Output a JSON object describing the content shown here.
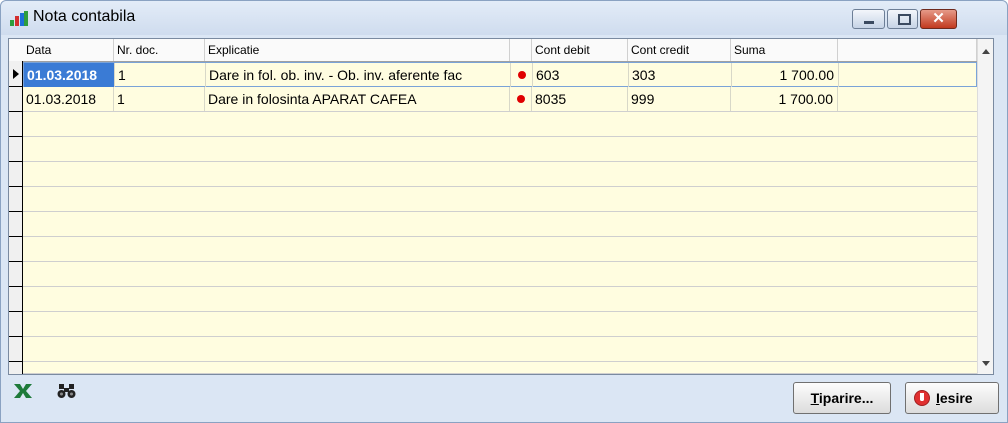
{
  "window": {
    "title": "Nota contabila"
  },
  "table": {
    "columns": [
      {
        "label": "Data"
      },
      {
        "label": "Nr. doc."
      },
      {
        "label": "Explicatie"
      },
      {
        "label": ""
      },
      {
        "label": "Cont debit"
      },
      {
        "label": "Cont credit"
      },
      {
        "label": "Suma"
      },
      {
        "label": ""
      }
    ],
    "rows": [
      {
        "data": "01.03.2018",
        "nr_doc": "1",
        "explicatie": "Dare in fol. ob. inv. - Ob. inv. aferente fac",
        "cont_debit": "603",
        "cont_credit": "303",
        "suma": "1 700.00",
        "selected": true
      },
      {
        "data": "01.03.2018",
        "nr_doc": "1",
        "explicatie": "Dare in folosinta APARAT CAFEA",
        "cont_debit": "8035",
        "cont_credit": "999",
        "suma": "1 700.00",
        "selected": false
      }
    ]
  },
  "buttons": {
    "print_first": "T",
    "print_rest": "iparire...",
    "exit_first": "I",
    "exit_rest": "esire"
  },
  "icons": {
    "app": "chart-icon",
    "excel": "excel-icon",
    "search": "binoculars-icon",
    "exit": "power-icon"
  },
  "colors": {
    "row_bg": "#fffde0",
    "selection": "#3a7bd5",
    "dot": "#e00000",
    "title_bg": "#dbe6f4"
  }
}
